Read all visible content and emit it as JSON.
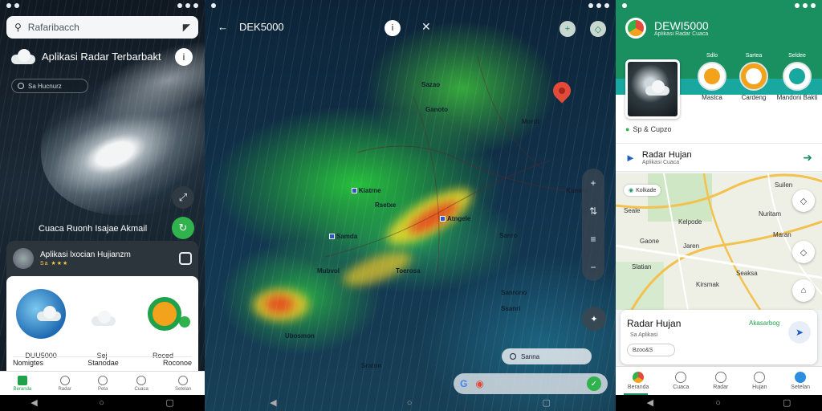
{
  "screen1": {
    "search": {
      "placeholder": "Rafaribacch"
    },
    "title": "Aplikasi Radar Terbarbakt",
    "chip": "Sa Hucnurz",
    "cuaca_label": "Cuaca Ruonh Isajae Akmail",
    "card": {
      "name": "Aplikasi lxocian Hujianzm",
      "rating_text": "Sa ★★★",
      "items": [
        {
          "label": "DUU5000"
        },
        {
          "label": "Sej"
        },
        {
          "label": "Roced"
        }
      ],
      "links": [
        "Nomigtes",
        "Stanodae",
        "Roconoe"
      ]
    },
    "bottom_nav": [
      "Beranda",
      "Radar",
      "Peta",
      "Cuaca",
      "Setelan"
    ]
  },
  "screen2": {
    "title": "DEK5000",
    "cities": [
      {
        "label": "Sazao"
      },
      {
        "label": "Ganoto"
      },
      {
        "label": "Mordt"
      },
      {
        "label": "Kanaks"
      },
      {
        "label": "Kiatrne"
      },
      {
        "label": "Rsetxe"
      },
      {
        "label": "Atngele"
      },
      {
        "label": "Samda"
      },
      {
        "label": "Sanro"
      },
      {
        "label": "Mubvol"
      },
      {
        "label": "Toerosa"
      },
      {
        "label": "Sanrono"
      },
      {
        "label": "Ssanri"
      },
      {
        "label": "Ubosmon"
      },
      {
        "label": "Sraton"
      }
    ],
    "legend": "Sanna",
    "search_icon": "google-g-icon"
  },
  "screen3": {
    "brand": {
      "name": "DEWI5000",
      "sub": "Aplikasi Radar Cuaca"
    },
    "features": [
      {
        "top": "Sdlo",
        "label": "Mastca"
      },
      {
        "top": "Sartea",
        "label": "Cardeng"
      },
      {
        "top": "Seldee",
        "label": "Mandoni Bakti"
      }
    ],
    "section": "Sp & Cupzo",
    "card": {
      "title": "Radar Hujan",
      "sub": "Aplikasi Cuaca"
    },
    "map_chip": "Kolkade",
    "map_labels": [
      "Seale",
      "Suilen",
      "Kelpode",
      "Nuritam",
      "Gaone",
      "Maran",
      "Jaren",
      "Slatian",
      "Kirsmak",
      "Seaksa"
    ],
    "bottom_card": {
      "title": "Radar Hujan",
      "link": "Akasarbog",
      "sub": "Sa Aplikasi",
      "pill": "Bzoo&S"
    },
    "bottom_nav": [
      "Beranda",
      "Cuaca",
      "Radar",
      "Hujan",
      "Setelan"
    ]
  }
}
